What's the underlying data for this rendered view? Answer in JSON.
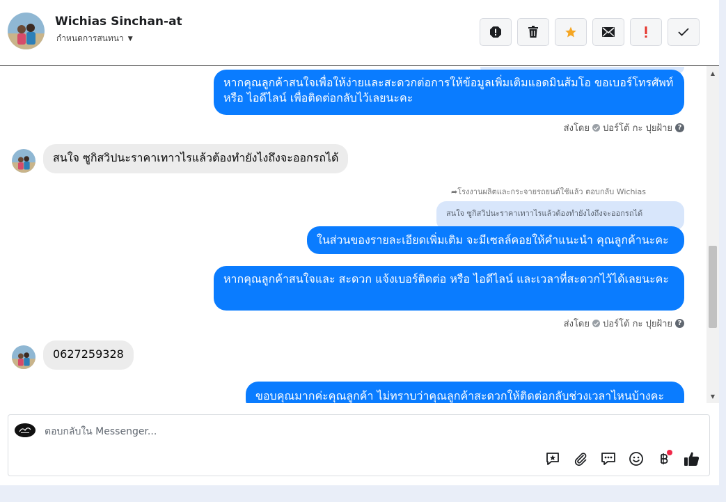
{
  "header": {
    "contact_name": "Wichias Sinchan-at",
    "assign_label": "กำหนดการสนทนา",
    "actions": [
      {
        "name": "spam-icon"
      },
      {
        "name": "trash-icon"
      },
      {
        "name": "star-icon"
      },
      {
        "name": "envelope-icon"
      },
      {
        "name": "exclamation-icon"
      },
      {
        "name": "check-icon"
      }
    ]
  },
  "conversation": {
    "messages": [
      {
        "from": "page",
        "text": "หากคุณลูกค้าสนใจเพื่อให้ง่ายและสะดวกต่อการให้ข้อมูลเพิ่มเติมแอดมินส้มโอ ขอเบอร์โทรศัพท์ หรือ ไอดีไลน์ เพื่อติดต่อกลับไว้เลยนะคะ"
      },
      {
        "from": "customer",
        "text": "สนใจ ซูกิสวิปนะราคาเทาาไรแล้วต้องทำยังไงถึงจะออกรถได้"
      },
      {
        "from": "page",
        "text": "ในส่วนของรายละเอียดเพิ่มเติม จะมีเซลล์คอยให้คำแนะนำ คุณลูกค้านะคะ"
      },
      {
        "from": "page",
        "text": "หากคุณลูกค้าสนใจและ สะดวก แจ้งเบอร์ติดต่อ หรือ ไอดีไลน์ และเวลาที่สะดวกไว้ได้เลยนะคะ"
      },
      {
        "from": "customer",
        "text": "0627259328"
      },
      {
        "from": "page",
        "text": "ขอบคุณมากค่ะคุณลูกค้า ไม่ทราบว่าคุณลูกค้าสะดวกให้ติดต่อกลับช่วงเวลาไหนบ้างคะ"
      }
    ],
    "sent_by_1": "ส่งโดย",
    "sender_1": "ปอร์โต้ กะ ปุยฝ้าย",
    "sent_by_2": "ส่งโดย",
    "sender_2": "ปอร์โต้ กะ ปุยฝ้าย",
    "reply_note": "โรงงานผลิตและกระจายรถยนต์ใช้แล้ว ตอบกลับ Wichias",
    "quoted_text": "สนใจ ซูกิสวิปนะราคาเทาาไรแล้วต้องทำยังไงถึงจะออกรถได้"
  },
  "composer": {
    "placeholder": "ตอบกลับใน Messenger...",
    "tools": [
      "saved-reply-icon",
      "attachment-icon",
      "chat-bubble-icon",
      "emoji-icon",
      "baht-payment-icon",
      "thumbs-up-icon"
    ]
  },
  "colors": {
    "outgoing_bubble": "#0a7cff",
    "incoming_bubble": "#ececec",
    "quoted_bubble": "#d8e6fb",
    "star": "#f5a623",
    "alert": "#e4342c"
  }
}
